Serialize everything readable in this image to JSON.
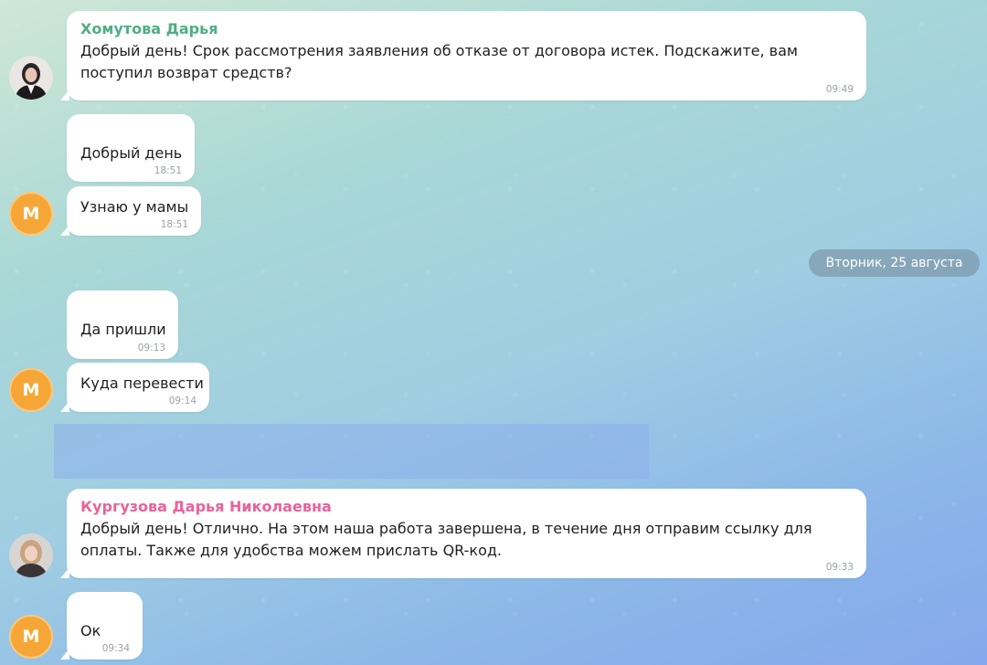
{
  "colors": {
    "sender_1": "#4fae85",
    "sender_2": "#e8639a",
    "avatar_letter_bg": "#f6a636"
  },
  "messages": [
    {
      "sender": "Хомутова Дарья",
      "text": "Добрый день! Срок рассмотрения заявления об отказе от договора истек. Подскажите, вам поступил возврат средств?",
      "time": "09:49"
    },
    {
      "text": "Добрый день",
      "time": "18:51"
    },
    {
      "text": "Узнаю у мамы",
      "time": "18:51"
    },
    {
      "text": "Да пришли",
      "time": "09:13"
    },
    {
      "text": "Куда перевести",
      "time": "09:14"
    },
    {
      "sender": "Кургузова Дарья Николаевна",
      "text": "Добрый день! Отлично. На этом наша работа завершена, в течение дня отправим ссылку для оплаты. Также для удобства можем прислать QR-код.",
      "time": "09:33"
    },
    {
      "text": "Ок",
      "time": "09:34"
    }
  ],
  "date_separator": "Вторник, 25 августа",
  "avatars": {
    "user_letter": "М"
  }
}
